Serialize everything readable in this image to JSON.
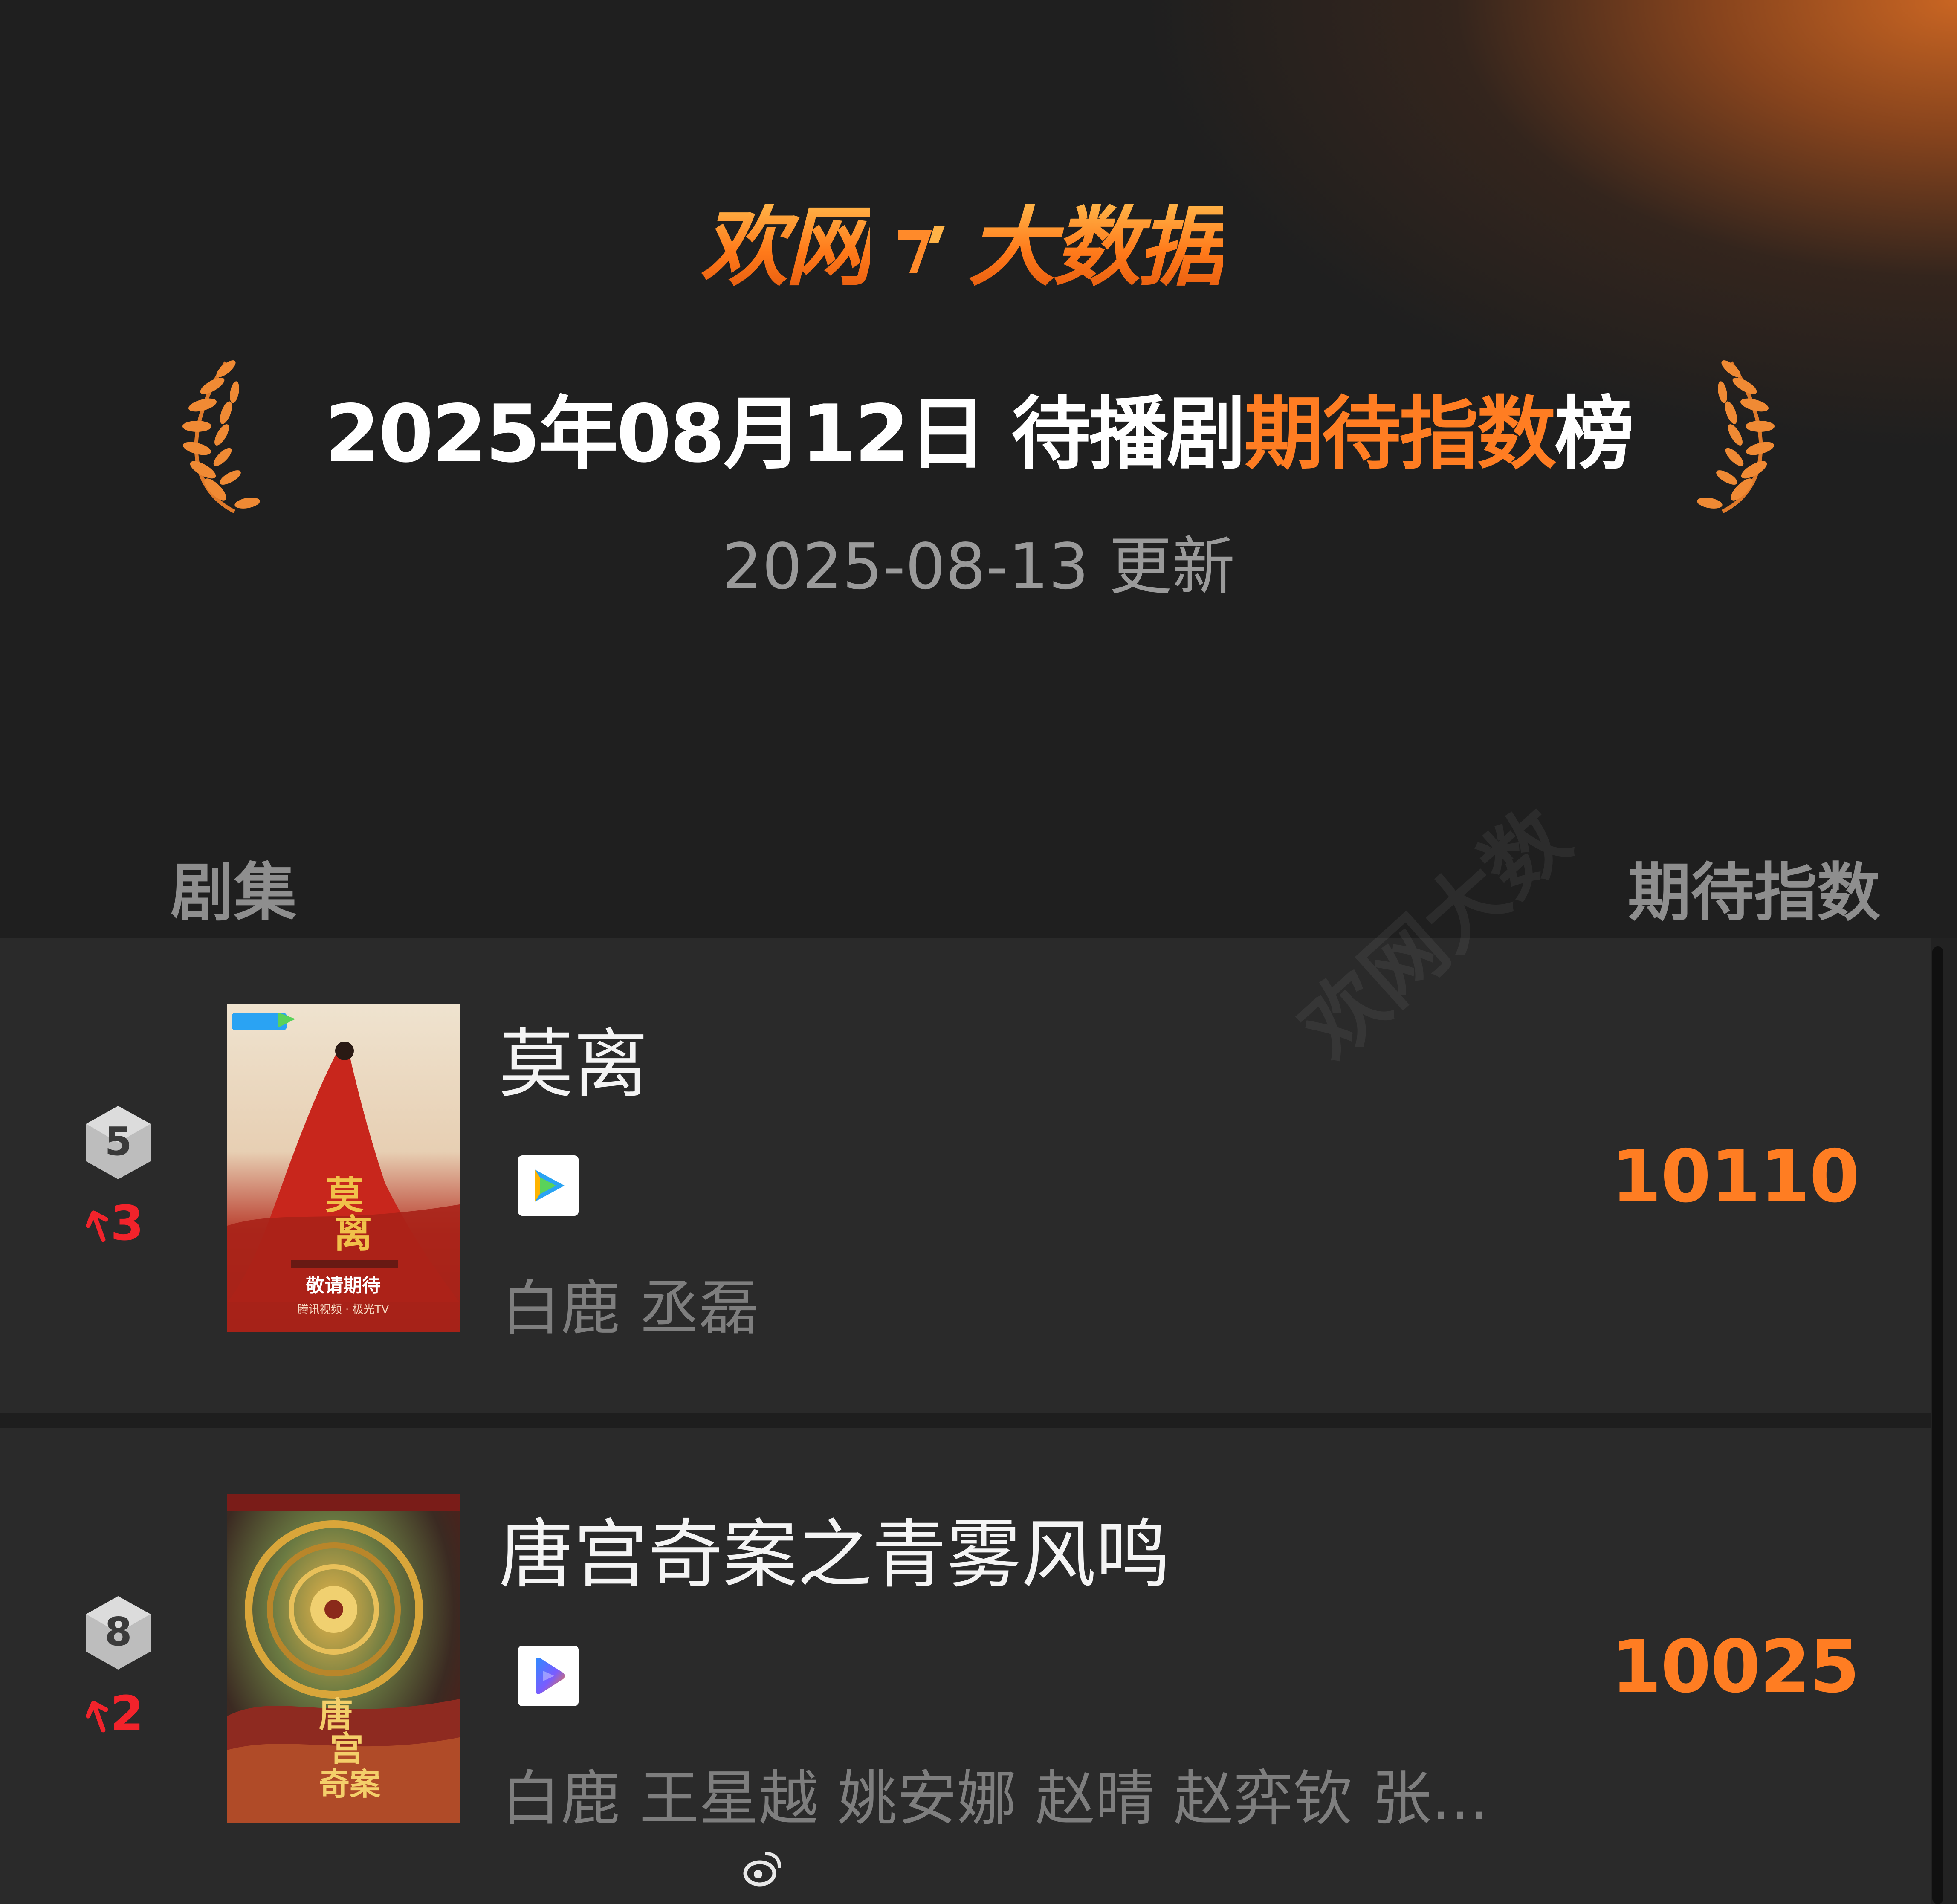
{
  "header": {
    "logo_text": "欢网大数据",
    "title_plain": "2025年08月12日 待播剧",
    "title_accent": "期待指数",
    "title_tail": "榜",
    "updated": "2025-08-13 更新"
  },
  "columns": {
    "left": "剧集",
    "right": "期待指数"
  },
  "rows": [
    {
      "rank": "5",
      "change": "3",
      "change_direction": "up",
      "title": "莫离",
      "platform_icon": "tencent-video-icon",
      "cast": "白鹿 丞磊",
      "score": "10110",
      "poster": {
        "text_main": "莫离",
        "text_banner": "敬请期待",
        "text_footer": "腾讯视频 · 极光TV"
      }
    },
    {
      "rank": "8",
      "change": "2",
      "change_direction": "up",
      "title": "唐宫奇案之青雾风鸣",
      "platform_icon": "youku-icon",
      "cast": "白鹿 王星越 姚安娜 赵晴 赵弈钦 张...",
      "score": "10025",
      "poster": {
        "text_main": "唐宫奇案"
      }
    }
  ],
  "watermark": "欢网大数",
  "colors": {
    "accent": "#ff7d22",
    "rank_up": "#f2232b",
    "row_bg": "#2a2a2a",
    "page_bg": "#1e1e1e"
  }
}
